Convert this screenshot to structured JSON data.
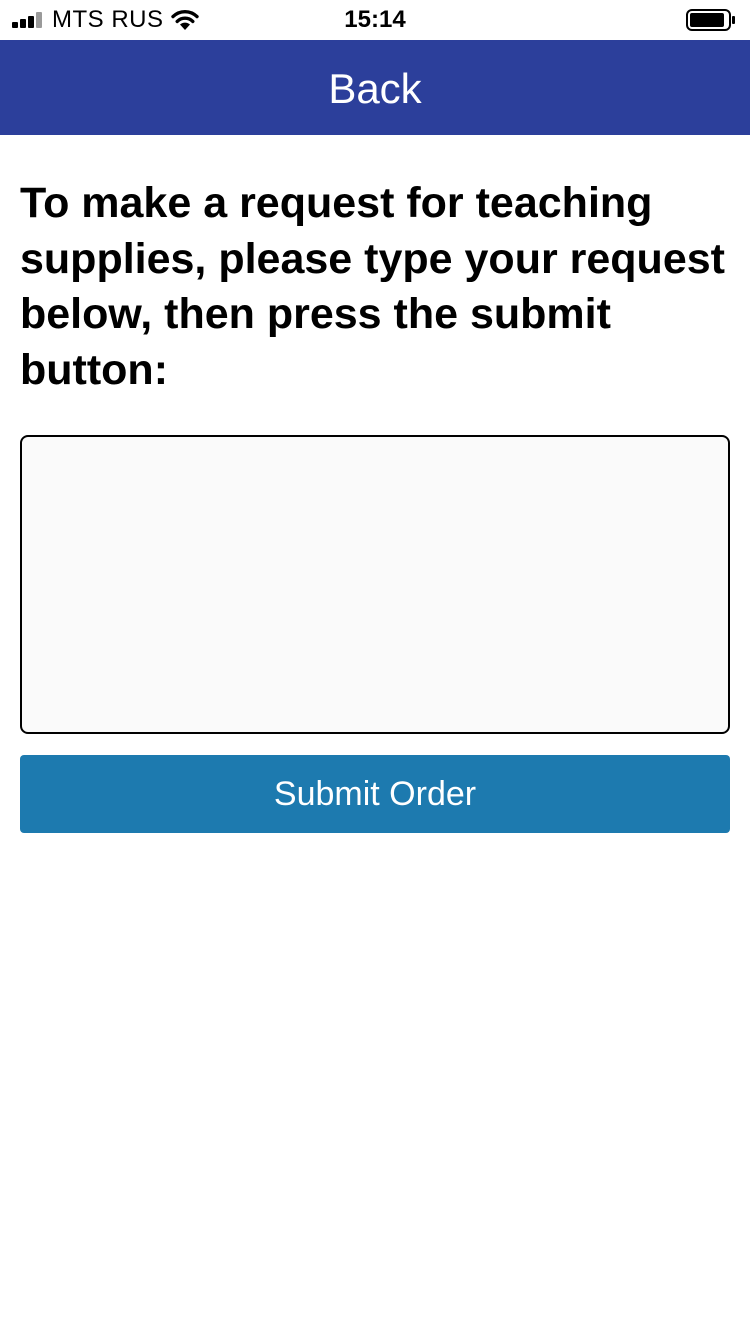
{
  "status_bar": {
    "carrier": "MTS RUS",
    "time": "15:14",
    "signal_icon": "cellular-signal-icon",
    "wifi_icon": "wifi-icon",
    "battery_icon": "battery-icon"
  },
  "nav_bar": {
    "back_label": "Back",
    "background_color": "#2c3f9b"
  },
  "content": {
    "instructions": "To make a request for teaching supplies, please type your request below, then press the submit button:",
    "request_input": {
      "value": "",
      "placeholder": ""
    },
    "submit_label": "Submit Order",
    "submit_color": "#1d7aaf"
  }
}
